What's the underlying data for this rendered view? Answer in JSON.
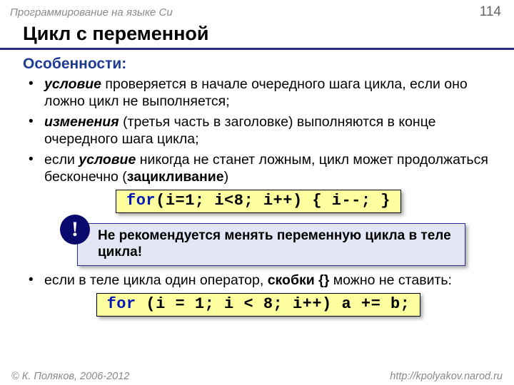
{
  "header": {
    "lecture": "Программирование на языке Си",
    "page": "114"
  },
  "title": "Цикл с переменной",
  "sub": "Особенности:",
  "bullets": {
    "b1_em": "условие",
    "b1_rest": " проверяется в начале очередного шага цикла, если оно ложно цикл не выполняется;",
    "b2_em": "изменения",
    "b2_rest": " (третья часть в заголовке) выполняются в конце очередного шага цикла;",
    "b3_a": "если ",
    "b3_em": "условие",
    "b3_b": " никогда не станет ложным, цикл может продолжаться бесконечно (",
    "b3_bold": "зацикливание",
    "b3_c": ")",
    "b4_a": "если в теле цикла один оператор, ",
    "b4_bold": "скобки {}",
    "b4_b": " можно не ставить:"
  },
  "code1": {
    "kw": "for",
    "rest": "(i=1; i<8; i++) { i--; }"
  },
  "warn": "Не рекомендуется менять переменную цикла в теле цикла!",
  "bang": "!",
  "code2": {
    "kw": "for",
    "rest": " (i = 1; i < 8; i++) a += b;"
  },
  "footer": {
    "copy": "© К. Поляков, 2006-2012",
    "url": "http://kpolyakov.narod.ru"
  }
}
